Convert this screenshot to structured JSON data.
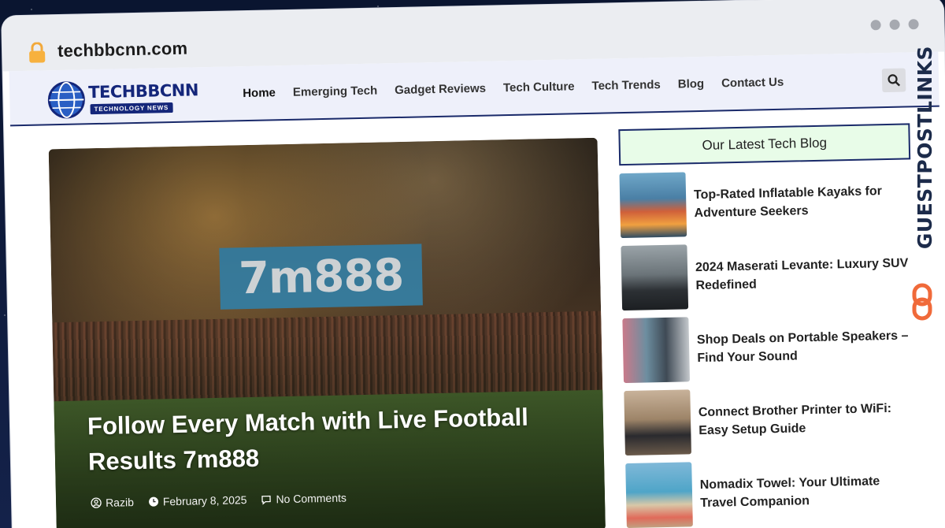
{
  "browser": {
    "url": "techbbcnn.com"
  },
  "site": {
    "logo_main": "TECHBBCNN",
    "logo_sub": "TECHNOLOGY NEWS",
    "nav": [
      {
        "label": "Home"
      },
      {
        "label": "Emerging Tech"
      },
      {
        "label": "Gadget Reviews"
      },
      {
        "label": "Tech Culture"
      },
      {
        "label": "Tech Trends"
      },
      {
        "label": "Blog"
      },
      {
        "label": "Contact Us"
      }
    ],
    "accent": "#14267a"
  },
  "hero": {
    "board_text": "7m888",
    "title": "Follow Every Match with Live Football Results 7m888",
    "author": "Razib",
    "date": "February 8, 2025",
    "comments": "No Comments"
  },
  "sidebar": {
    "heading": "Our Latest Tech Blog",
    "posts": [
      {
        "title": "Top-Rated Inflatable Kayaks for Adventure Seekers"
      },
      {
        "title": "2024 Maserati Levante: Luxury SUV Redefined"
      },
      {
        "title": "Shop Deals on Portable Speakers – Find Your Sound"
      },
      {
        "title": "Connect Brother Printer to WiFi: Easy Setup Guide"
      },
      {
        "title": "Nomadix Towel: Your Ultimate Travel Companion"
      }
    ]
  },
  "overlay": {
    "brand": "GUESTPOSTLINKS",
    "brand_color": "#1c2b4a",
    "icon_color": "#f06a3a"
  }
}
